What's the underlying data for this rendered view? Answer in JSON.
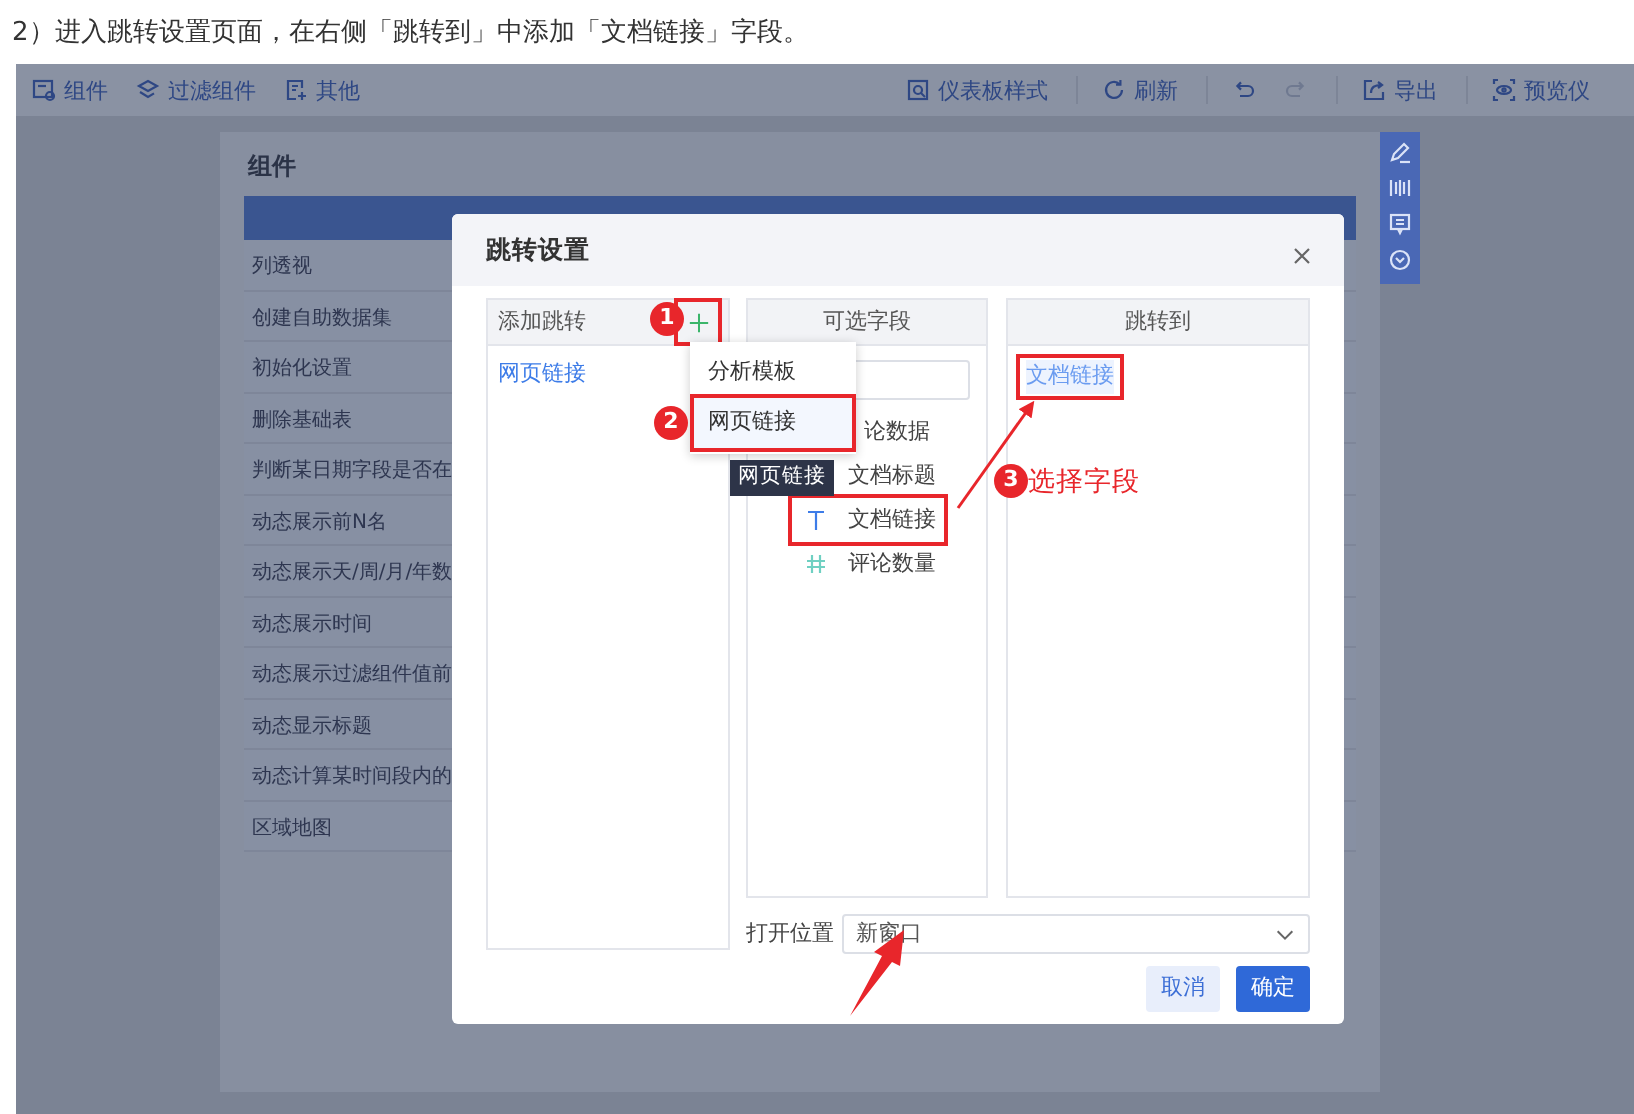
{
  "caption": "2）进入跳转设置页面，在右侧「跳转到」中添加「文档链接」字段。",
  "toolbar": {
    "left": [
      {
        "label": "组件",
        "kind": "component"
      },
      {
        "label": "过滤组件",
        "kind": "filter"
      },
      {
        "label": "其他",
        "kind": "other"
      }
    ],
    "right": [
      {
        "label": "仪表板样式",
        "kind": "style",
        "disabled": false
      },
      {
        "label": "刷新",
        "kind": "refresh",
        "disabled": false
      },
      {
        "kind": "undo",
        "disabled": false
      },
      {
        "kind": "redo",
        "disabled": true
      },
      {
        "label": "导出",
        "kind": "export",
        "disabled": false
      },
      {
        "label": "预览仪",
        "kind": "preview",
        "disabled": false
      }
    ]
  },
  "panel": {
    "title": "组件",
    "items": [
      "列透视",
      "创建自助数据集",
      "初始化设置",
      "删除基础表",
      "判断某日期字段是否在",
      "动态展示前N名",
      "动态展示天/周/月/年数",
      "动态展示时间",
      "动态展示过滤组件值前",
      "动态显示标题",
      "动态计算某时间段内的",
      "区域地图"
    ]
  },
  "dialog": {
    "title": "跳转设置",
    "add_jump": {
      "header": "添加跳转",
      "add_highlighted": true,
      "items": [
        {
          "label": "网页链接"
        }
      ]
    },
    "fields": {
      "header": "可选字段",
      "items": [
        {
          "label": "论数据",
          "kind": "hidden",
          "highlighted": false
        },
        {
          "label": "文档标题",
          "kind": "hidden",
          "highlighted": false
        },
        {
          "label": "文档链接",
          "kind": "text",
          "highlighted": true
        },
        {
          "label": "评论数量",
          "kind": "number",
          "highlighted": false
        }
      ]
    },
    "target": {
      "header": "跳转到",
      "items": [
        {
          "label": "文档链接",
          "highlighted": true
        }
      ]
    },
    "open_position": {
      "label": "打开位置",
      "value": "新窗口"
    },
    "buttons": [
      {
        "label": "取消",
        "kind": "secondary"
      },
      {
        "label": "确定",
        "kind": "primary"
      }
    ]
  },
  "menu": {
    "items": [
      {
        "label": "分析模板",
        "selected": false,
        "highlighted": false
      },
      {
        "label": "网页链接",
        "selected": true,
        "highlighted": true
      }
    ]
  },
  "tooltip": "网页链接",
  "annotations": [
    {
      "number": "1"
    },
    {
      "number": "2"
    },
    {
      "number": "3",
      "text": "选择字段"
    }
  ]
}
